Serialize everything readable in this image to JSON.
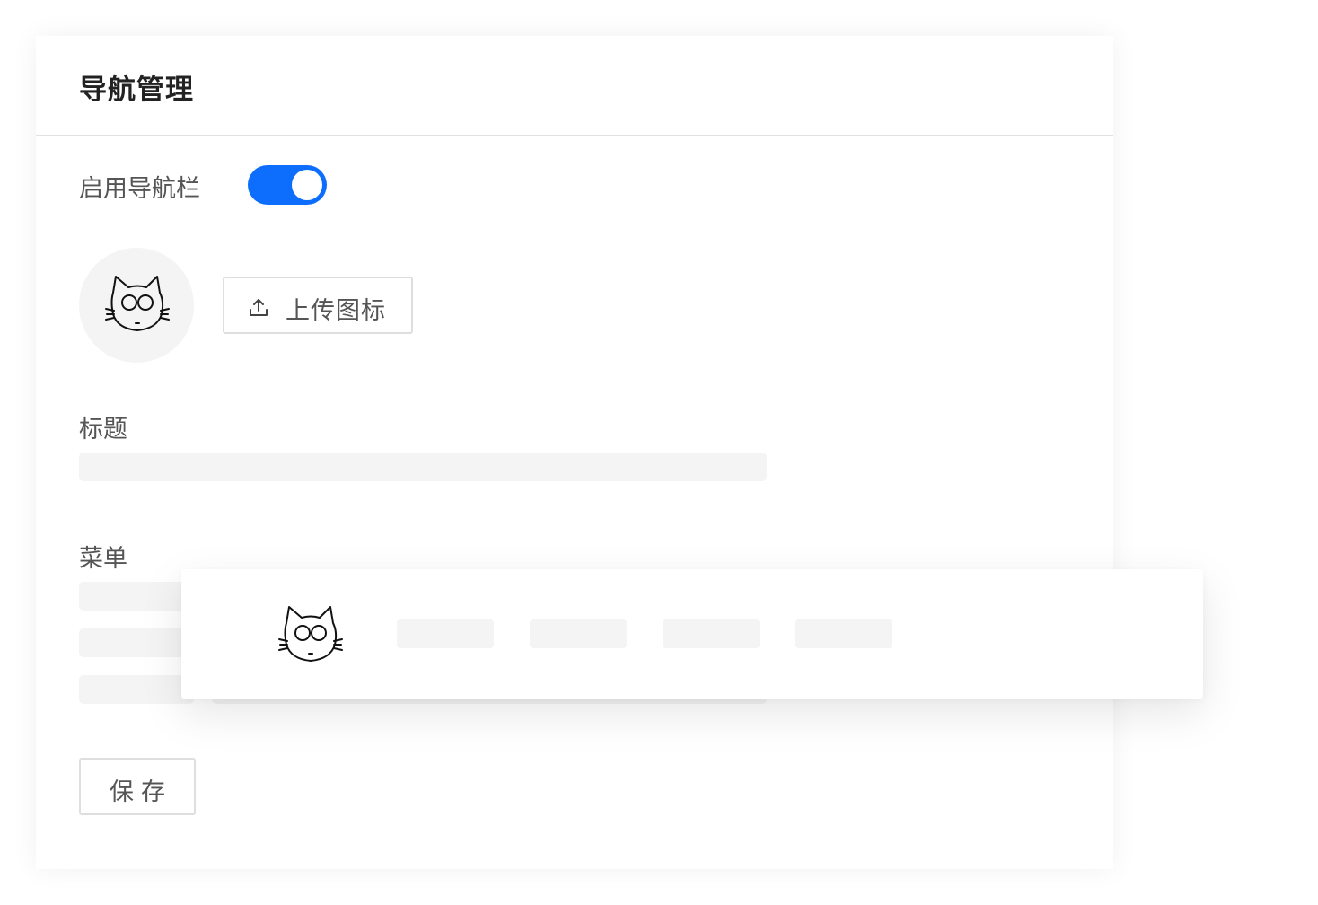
{
  "panel": {
    "title": "导航管理"
  },
  "toggle": {
    "label": "启用导航栏",
    "enabled": true,
    "accent_color": "#0d6efd"
  },
  "logo": {
    "icon": "cat-face-icon"
  },
  "upload": {
    "label": "上传图标",
    "icon": "upload-icon"
  },
  "title_field": {
    "label": "标题"
  },
  "menu_field": {
    "label": "菜单"
  },
  "save": {
    "label": "保存"
  },
  "navbar_preview": {
    "logo_icon": "cat-face-icon",
    "item_count": 4
  }
}
